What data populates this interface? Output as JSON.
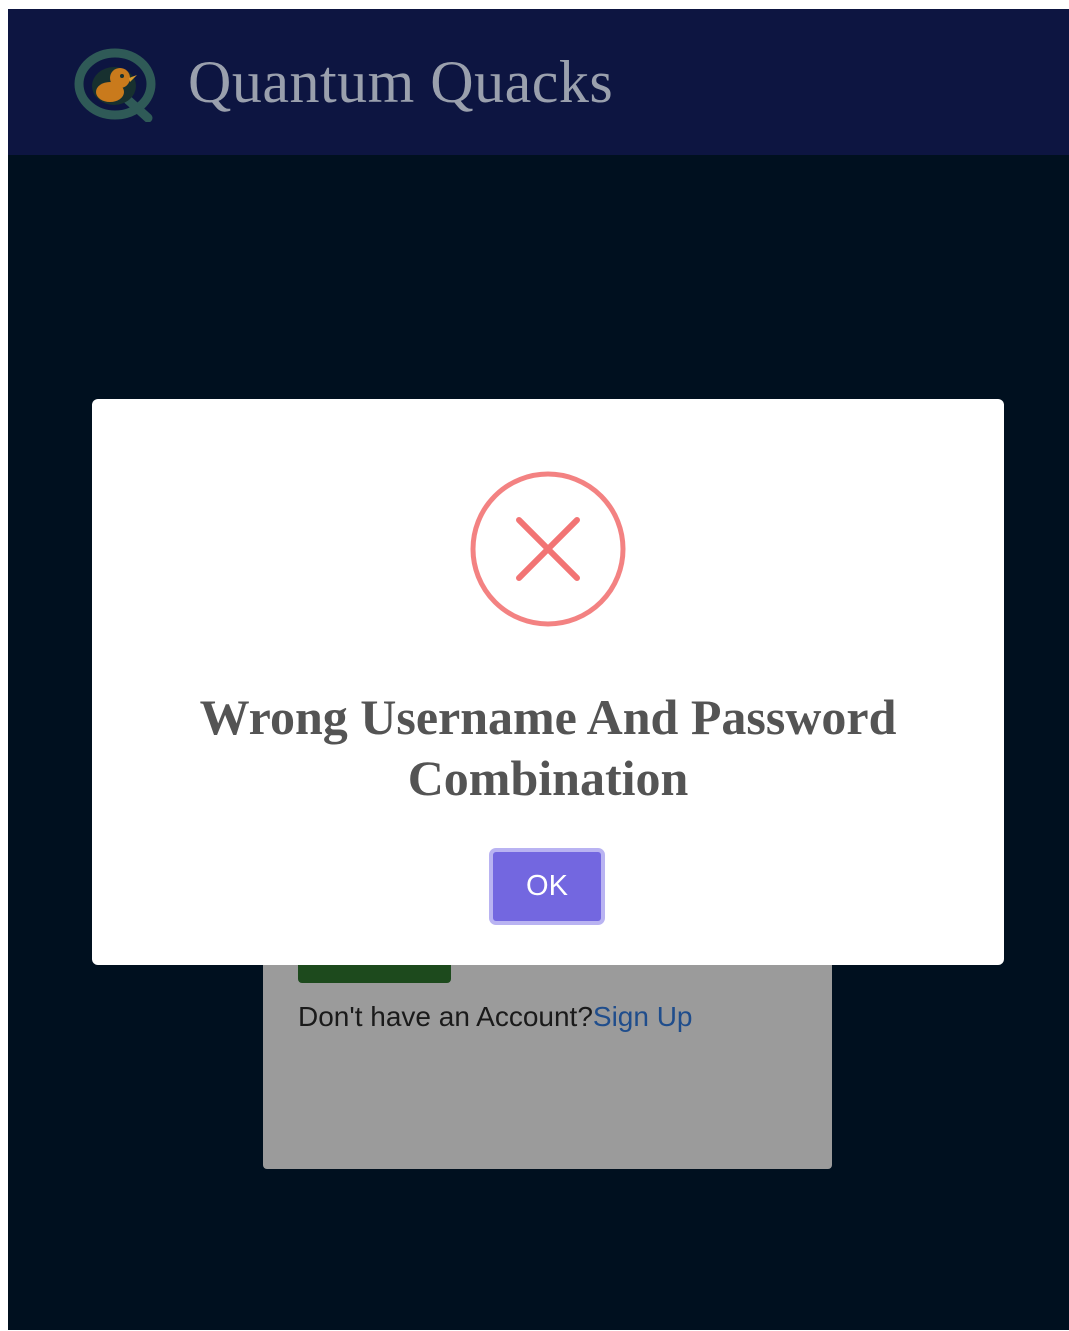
{
  "navbar": {
    "brand": "Quantum Quacks",
    "logo_icon": "quantum-quacks-duck-logo"
  },
  "login_card": {
    "signup_prompt": "Don't have an Account?",
    "signup_link": "Sign Up"
  },
  "modal": {
    "icon": "error-x-icon",
    "title": "Wrong Username And Password Combination",
    "ok_label": "OK"
  },
  "colors": {
    "navbar_bg": "#0d1541",
    "page_bg": "#00101f",
    "error_icon": "#f27474",
    "ok_button": "#7367e0",
    "link": "#1f4d8c"
  }
}
